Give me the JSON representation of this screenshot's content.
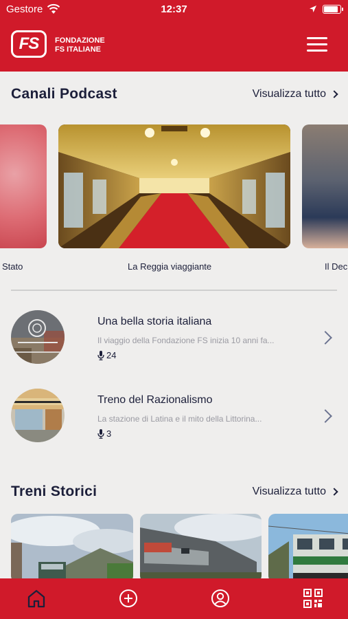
{
  "status_bar": {
    "carrier": "Gestore",
    "time": "12:37"
  },
  "header": {
    "logo_text": "FS",
    "brand_line1": "FONDAZIONE",
    "brand_line2": "FS ITALIANE",
    "menu_icon": "hamburger-icon"
  },
  "podcast_section": {
    "title": "Canali Podcast",
    "see_all": "Visualizza tutto",
    "cards": [
      {
        "label": "Stato"
      },
      {
        "label": "La Reggia viaggiante"
      },
      {
        "label": "Il Dec"
      }
    ]
  },
  "episodes": [
    {
      "title": "Una bella storia italiana",
      "description": "Il viaggio della Fondazione FS inizia 10 anni fa...",
      "count": "24"
    },
    {
      "title": "Treno del Razionalismo",
      "description": "La stazione di Latina e il mito della Littorina...",
      "count": "3"
    }
  ],
  "trains_section": {
    "title": "Treni Storici",
    "see_all": "Visualizza tutto"
  },
  "tabbar": {
    "icons": [
      "home-icon",
      "add-icon",
      "profile-icon",
      "qr-code-icon"
    ]
  },
  "colors": {
    "brand_red": "#d01a2a",
    "text_navy": "#1c1f3a",
    "background": "#efeeed"
  }
}
